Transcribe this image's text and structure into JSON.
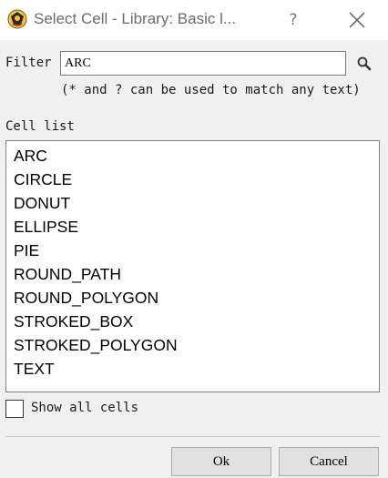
{
  "window": {
    "title": "Select Cell - Library: Basic l...",
    "help_symbol": "?",
    "icons": {
      "app": "app-logo-icon",
      "close": "close-icon",
      "search": "magnifier-icon"
    }
  },
  "filter": {
    "label": "Filter",
    "value": "ARC",
    "hint": "(* and ? can be used to match any text)"
  },
  "cell_list": {
    "label": "Cell list",
    "items": [
      "ARC",
      "CIRCLE",
      "DONUT",
      "ELLIPSE",
      "PIE",
      "ROUND_PATH",
      "ROUND_POLYGON",
      "STROKED_BOX",
      "STROKED_POLYGON",
      "TEXT"
    ]
  },
  "show_all": {
    "label": "Show all cells",
    "checked": false
  },
  "buttons": {
    "ok": "Ok",
    "cancel": "Cancel"
  },
  "colors": {
    "dialog_bg": "#f0f0f0",
    "titlebar_bg": "#ffffff",
    "button_bg": "#e1e1e1",
    "button_border": "#adadad"
  }
}
